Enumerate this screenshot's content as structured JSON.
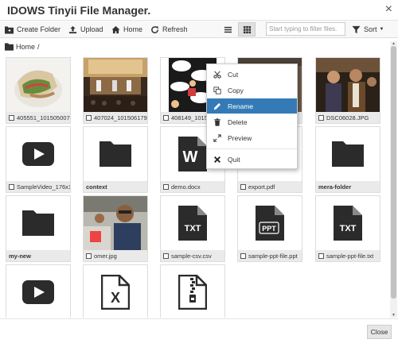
{
  "window": {
    "title": "IDOWS Tinyii File Manager.",
    "close_glyph": "×"
  },
  "toolbar": {
    "create_folder": "Create Folder",
    "upload": "Upload",
    "home": "Home",
    "refresh": "Refresh",
    "filter_placeholder": "Start typing to filter files.",
    "sort": "Sort"
  },
  "breadcrumb": {
    "root": "Home",
    "separator": "/"
  },
  "files": [
    {
      "name": "405551_101505007",
      "kind": "image-sandwich"
    },
    {
      "name": "407024_101506179",
      "kind": "image-stage"
    },
    {
      "name": "408149_101507",
      "kind": "image-comic"
    },
    {
      "name": "",
      "kind": "image-hidden"
    },
    {
      "name": "DSC06028.JPG",
      "kind": "image-people"
    },
    {
      "name": "SampleVideo_176x1",
      "kind": "video-icon"
    },
    {
      "name": "context",
      "kind": "folder-icon",
      "bold": true
    },
    {
      "name": "demo.docx",
      "kind": "word-icon"
    },
    {
      "name": "export.pdf",
      "kind": "pdf-hidden"
    },
    {
      "name": "mera-folder",
      "kind": "folder-icon",
      "bold": true
    },
    {
      "name": "my-new",
      "kind": "folder-icon",
      "bold": true
    },
    {
      "name": "omer.jpg",
      "kind": "image-omer"
    },
    {
      "name": "sample-csv.csv",
      "kind": "txt-icon",
      "icon_text": "TXT"
    },
    {
      "name": "sample-ppt-file.ppt",
      "kind": "ppt-icon",
      "icon_text": "PPT"
    },
    {
      "name": "sample-ppt-file.txt",
      "kind": "txt-icon",
      "icon_text": "TXT"
    },
    {
      "name": "",
      "kind": "video-icon"
    },
    {
      "name": "",
      "kind": "excel-icon",
      "icon_text": "X"
    },
    {
      "name": "",
      "kind": "zip-icon"
    }
  ],
  "context_menu": {
    "items": [
      {
        "label": "Cut",
        "icon": "scissors-icon"
      },
      {
        "label": "Copy",
        "icon": "copy-icon"
      },
      {
        "label": "Rename",
        "icon": "pencil-icon",
        "active": true
      },
      {
        "label": "Delete",
        "icon": "trash-icon"
      },
      {
        "label": "Preview",
        "icon": "expand-icon"
      },
      {
        "label": "Quit",
        "icon": "x-icon"
      }
    ]
  },
  "footer": {
    "close": "Close"
  },
  "colors": {
    "accent": "#337ab7",
    "tile_label_bg": "#eaeaea",
    "icon_dark": "#2b2b2b"
  }
}
